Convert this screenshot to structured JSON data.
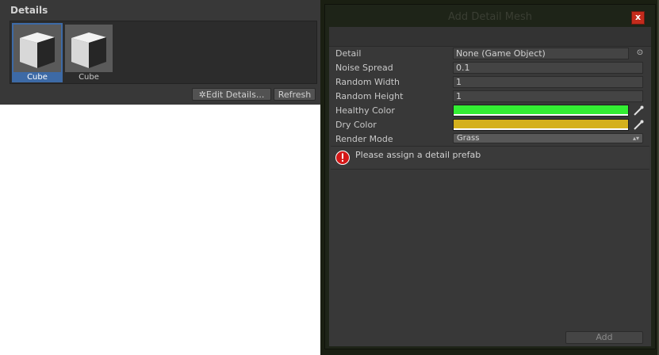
{
  "details_panel": {
    "title": "Details",
    "items": [
      {
        "label": "Cube",
        "selected": true,
        "icon": "cube-icon"
      },
      {
        "label": "Cube",
        "selected": false,
        "icon": "cube-icon"
      }
    ],
    "edit_details_label": "Edit Details...",
    "edit_details_icon": "gear-icon",
    "refresh_label": "Refresh"
  },
  "dialog": {
    "title": "Add Detail Mesh",
    "close_label": "x",
    "properties": {
      "detail": {
        "label": "Detail",
        "value": "None (Game Object)"
      },
      "noise_spread": {
        "label": "Noise Spread",
        "value": "0.1"
      },
      "random_width": {
        "label": "Random Width",
        "value": "1"
      },
      "random_height": {
        "label": "Random Height",
        "value": "1"
      },
      "healthy_color": {
        "label": "Healthy Color",
        "color": "#33ee33"
      },
      "dry_color": {
        "label": "Dry Color",
        "color": "#d4b01c"
      },
      "render_mode": {
        "label": "Render Mode",
        "value": "Grass"
      }
    },
    "help": {
      "icon": "error-icon",
      "text": "Please assign a detail prefab"
    },
    "add_label": "Add"
  },
  "colors": {
    "panel_bg": "#383838",
    "selection": "#3d6aa6",
    "close_red": "#c42b1c"
  }
}
